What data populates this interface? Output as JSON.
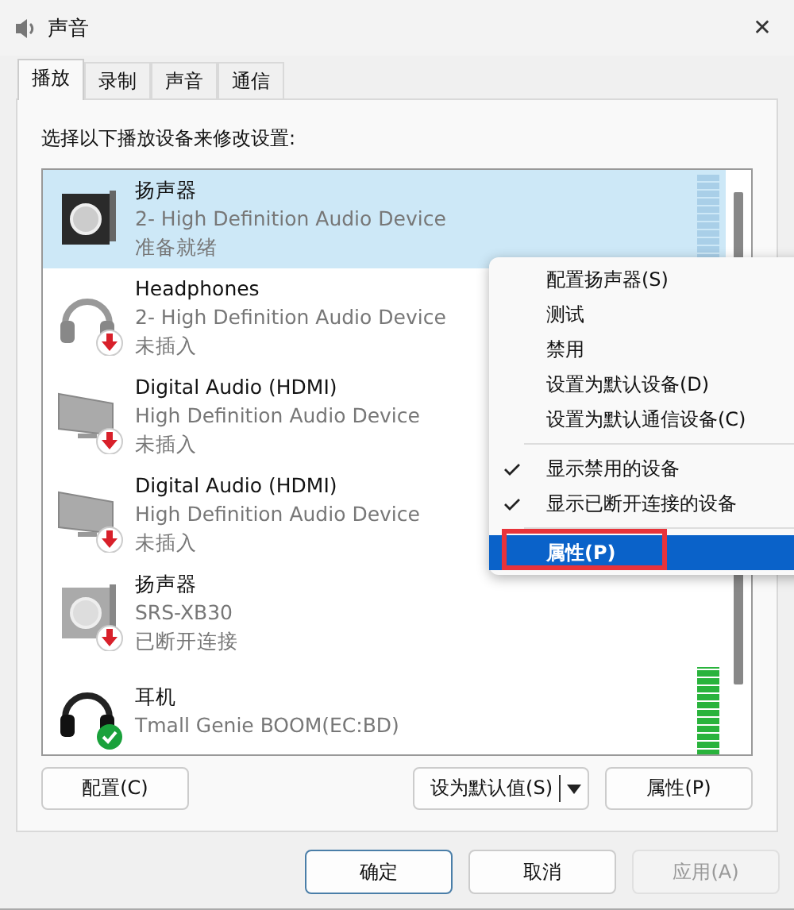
{
  "window": {
    "title": "声音",
    "close": "✕"
  },
  "tabs": [
    {
      "label": "播放",
      "selected": true
    },
    {
      "label": "录制",
      "selected": false
    },
    {
      "label": "声音",
      "selected": false
    },
    {
      "label": "通信",
      "selected": false
    }
  ],
  "instruction": "选择以下播放设备来修改设置:",
  "devices": [
    {
      "kind": "speaker",
      "unplugged": false,
      "default": false,
      "name": "扬声器",
      "description": "2- High Definition Audio Device",
      "status": "准备就绪",
      "selected": true,
      "level": 0
    },
    {
      "kind": "headphones",
      "unplugged": true,
      "default": false,
      "name": "Headphones",
      "description": "2- High Definition Audio Device",
      "status": "未插入",
      "selected": false
    },
    {
      "kind": "monitor",
      "unplugged": true,
      "default": false,
      "name": "Digital Audio (HDMI)",
      "description": "High Definition Audio Device",
      "status": "未插入",
      "selected": false
    },
    {
      "kind": "monitor",
      "unplugged": true,
      "default": false,
      "name": "Digital Audio (HDMI)",
      "description": "High Definition Audio Device",
      "status": "未插入",
      "selected": false
    },
    {
      "kind": "box",
      "unplugged": true,
      "default": false,
      "name": "扬声器",
      "description": "SRS-XB30",
      "status": "已断开连接",
      "selected": false
    },
    {
      "kind": "headset",
      "unplugged": false,
      "default": true,
      "name": "耳机",
      "description": "Tmall Genie BOOM(EC:BD)",
      "selected": false,
      "level": 1
    }
  ],
  "panel_buttons": [
    {
      "label": "配置(C)",
      "kind": "plain"
    },
    {
      "label": "设为默认值(S)",
      "kind": "split"
    },
    {
      "label": "属性(P)",
      "kind": "plain"
    }
  ],
  "dialog_buttons": [
    {
      "label": "确定",
      "disabled": false,
      "default": true
    },
    {
      "label": "取消",
      "disabled": false,
      "default": false
    },
    {
      "label": "应用(A)",
      "disabled": true,
      "default": false
    }
  ],
  "context_menu": {
    "groups": [
      [
        {
          "label": "配置扬声器(S)",
          "checked": false,
          "selected": false
        },
        {
          "label": "测试",
          "checked": false,
          "selected": false
        },
        {
          "label": "禁用",
          "checked": false,
          "selected": false
        },
        {
          "label": "设置为默认设备(D)",
          "checked": false,
          "selected": false
        },
        {
          "label": "设置为默认通信设备(C)",
          "checked": false,
          "selected": false
        }
      ],
      [
        {
          "label": "显示禁用的设备",
          "checked": true,
          "selected": false
        },
        {
          "label": "显示已断开连接的设备",
          "checked": true,
          "selected": false
        }
      ],
      [
        {
          "label": "属性(P)",
          "checked": false,
          "selected": true,
          "annotated": true
        }
      ]
    ]
  }
}
